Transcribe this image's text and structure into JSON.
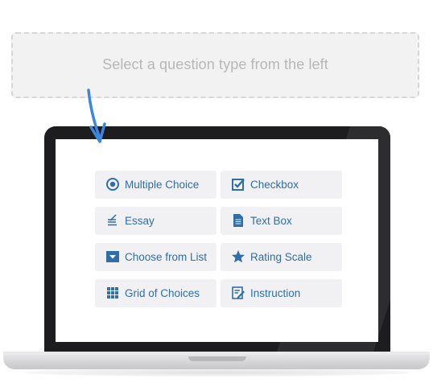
{
  "dropzone": {
    "text": "Select a question type from the left"
  },
  "question_types": [
    {
      "label": "Multiple Choice",
      "icon": "radio-button-icon"
    },
    {
      "label": "Checkbox",
      "icon": "checkbox-icon"
    },
    {
      "label": "Essay",
      "icon": "essay-lines-icon"
    },
    {
      "label": "Text Box",
      "icon": "document-icon"
    },
    {
      "label": "Choose from List",
      "icon": "dropdown-icon"
    },
    {
      "label": "Rating Scale",
      "icon": "star-icon"
    },
    {
      "label": "Grid of Choices",
      "icon": "grid-icon"
    },
    {
      "label": "Instruction",
      "icon": "instruction-icon"
    }
  ],
  "colors": {
    "accent": "#2f6ea8",
    "button_bg": "#f1f1f3",
    "arrow": "#3a86e0",
    "placeholder_text": "#b7b7b7"
  }
}
